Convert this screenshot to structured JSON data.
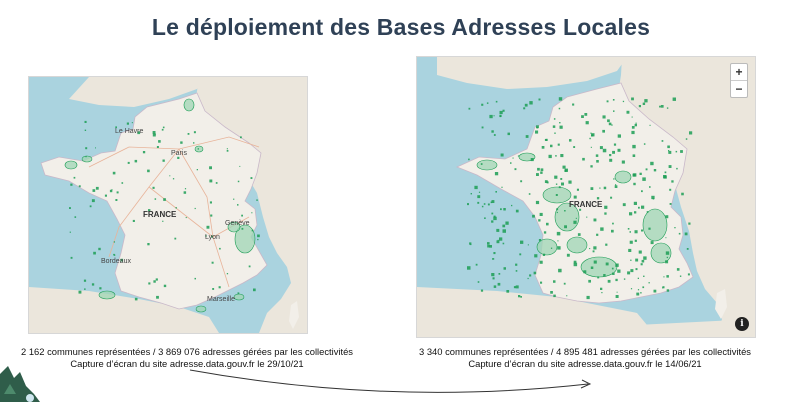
{
  "slide": {
    "title": "Le déploiement des Bases Adresses Locales"
  },
  "map_left": {
    "country_label": "FRANCE",
    "city_labels": [
      "Le Havre",
      "Paris",
      "Genève",
      "Lyon",
      "Bordeaux",
      "Marseille"
    ],
    "caption_line1": "2 162 communes représentées / 3 869 076 adresses gérées par les collectivités",
    "caption_line2": "Capture d’écran du site adresse.data.gouv.fr le 29/10/21"
  },
  "map_right": {
    "country_label": "FRANCE",
    "zoom_in_label": "+",
    "zoom_out_label": "−",
    "info_label": "i",
    "caption_line1": "3 340 communes représentées / 4 895 481 adresses gérées par les collectivités",
    "caption_line2": "Capture d’écran du site adresse.data.gouv.fr le 14/06/21"
  },
  "colors": {
    "sea": "#aad3df",
    "land": "#f2efe9",
    "neighbour_land": "#ebe6dc",
    "commune_fill": "#9fd6b4",
    "commune_stroke": "#1c9d55",
    "title": "#2f4156"
  }
}
